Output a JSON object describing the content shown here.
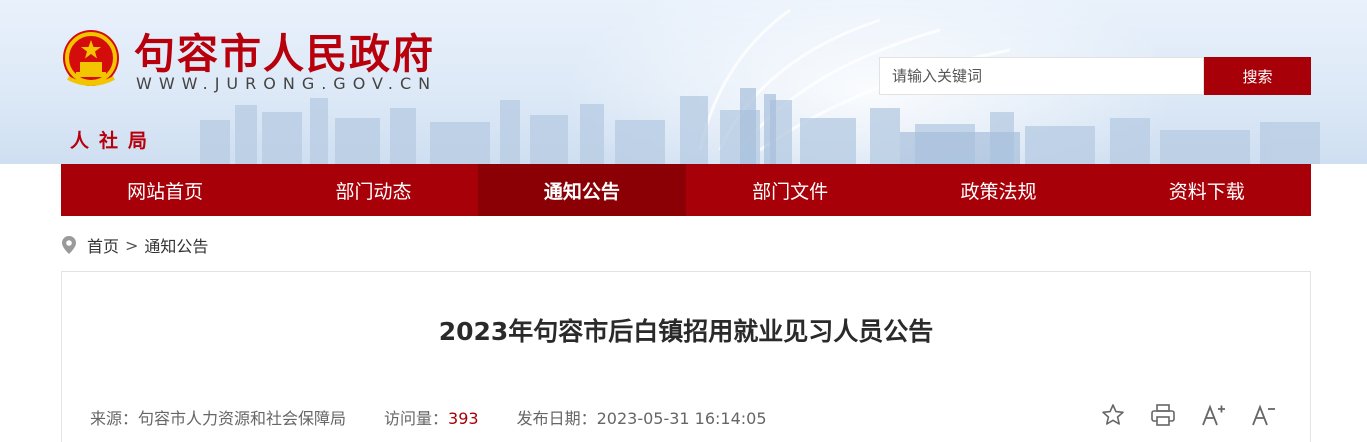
{
  "header": {
    "site_title": "句容市人民政府",
    "site_domain": "WWW.JURONG.GOV.CN",
    "dept_label": "人社局",
    "emblem_icon": "national-emblem-icon",
    "brand_color": "#a80008"
  },
  "search": {
    "placeholder": "请输入关键词",
    "button_label": "搜索"
  },
  "nav": {
    "items": [
      {
        "label": "网站首页"
      },
      {
        "label": "部门动态"
      },
      {
        "label": "通知公告",
        "active": true
      },
      {
        "label": "部门文件"
      },
      {
        "label": "政策法规"
      },
      {
        "label": "资料下载"
      }
    ]
  },
  "breadcrumb": {
    "icon": "location-pin-icon",
    "home": "首页",
    "separator": ">",
    "current": "通知公告"
  },
  "article": {
    "title": "2023年句容市后白镇招用就业见习人员公告",
    "source_label": "来源：",
    "source": "句容市人力资源和社会保障局",
    "views_label": "访问量：",
    "views": "393",
    "date_label": "发布日期：",
    "date": "2023-05-31 16:14:05",
    "tools": [
      "star-icon",
      "print-icon",
      "font-increase-icon",
      "font-decrease-icon"
    ]
  }
}
